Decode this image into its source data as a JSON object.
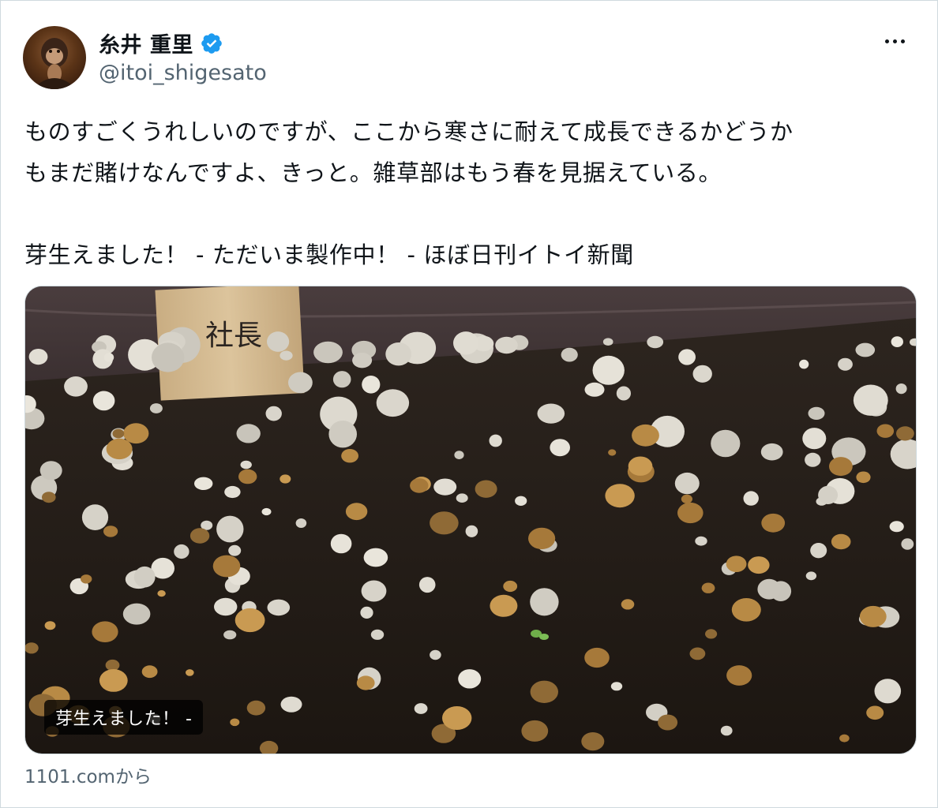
{
  "author": {
    "display_name": "糸井 重里",
    "handle": "@itoi_shigesato",
    "verified": true
  },
  "icons": {
    "verified": "verified-badge-icon",
    "more": "more-options-icon"
  },
  "tweet": {
    "line1": "ものすごくうれしいのですが、ここから寒さに耐えて成長できるかどうか",
    "line2": "もまだ賭けなんですよ、きっと。雑草部はもう春を見据えている。",
    "link_title": "芽生えました！ - ただいま製作中！ - ほぼ日刊イトイ新聞"
  },
  "card": {
    "caption": "芽生えました！ -",
    "sign_text": "社長",
    "source": "1101.comから"
  },
  "colors": {
    "verified_blue": "#1d9bf0",
    "secondary_text": "#536471",
    "border": "#cfd9de"
  }
}
